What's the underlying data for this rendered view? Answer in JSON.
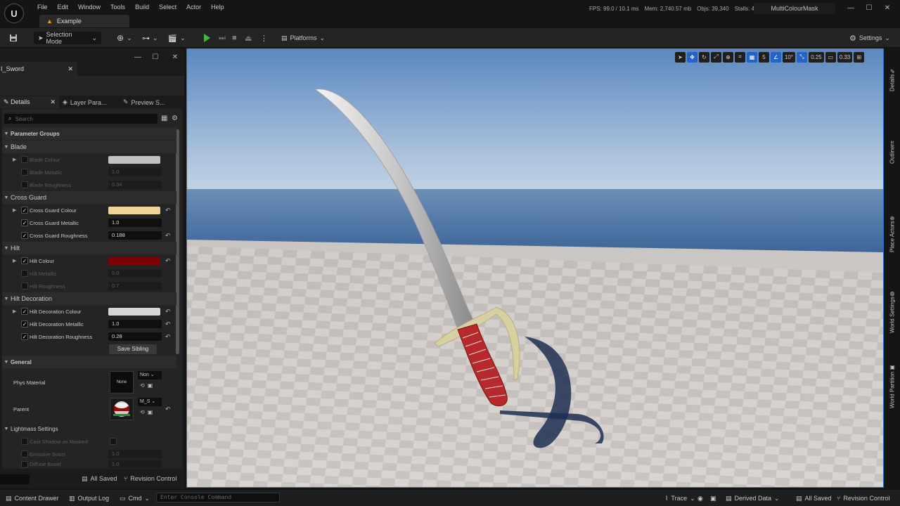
{
  "menu": [
    "File",
    "Edit",
    "Window",
    "Tools",
    "Build",
    "Select",
    "Actor",
    "Help"
  ],
  "level_tab": "Example",
  "stats": {
    "fps": "FPS: 99.0",
    "ms": "/ 10.1 ms",
    "mem": "Mem: 2,740.57 mb",
    "objs": "Objs: 39,340",
    "stalls": "Stalls: 4"
  },
  "project_name": "MultiColourMask",
  "toolbar": {
    "selection_mode": "Selection Mode",
    "platforms": "Platforms",
    "settings": "Settings"
  },
  "asset_tab": "I_Sword",
  "subtabs": [
    "Details",
    "Layer Para...",
    "Preview S..."
  ],
  "search_placeholder": "Search",
  "parameter_groups_label": "Parameter Groups",
  "groups": {
    "blade": {
      "label": "Blade",
      "colour_label": "Blade Colour",
      "colour_hex": "#c2c2c2",
      "metallic_label": "Blade Metallic",
      "metallic_value": "1.0",
      "roughness_label": "Blade Roughness",
      "roughness_value": "0.34"
    },
    "cross_guard": {
      "label": "Cross Guard",
      "colour_label": "Cross Guard Colour",
      "colour_hex": "#f0d39a",
      "metallic_label": "Cross Guard Metallic",
      "metallic_value": "1.0",
      "roughness_label": "Cross Guard Roughness",
      "roughness_value": "0.188"
    },
    "hilt": {
      "label": "Hilt",
      "colour_label": "Hilt Colour",
      "colour_hex": "#7a0404",
      "metallic_label": "Hilt Metallic",
      "metallic_value": "0.0",
      "roughness_label": "Hilt Roughness",
      "roughness_value": "0.7"
    },
    "hilt_decoration": {
      "label": "Hilt Decoration",
      "colour_label": "Hilt Decoration Colour",
      "colour_hex": "#d6d6d6",
      "metallic_label": "Hilt Decoration Metallic",
      "metallic_value": "1.0",
      "roughness_label": "Hilt Decoration Roughness",
      "roughness_value": "0.28"
    }
  },
  "save_sibling": "Save Sibling",
  "general": {
    "label": "General",
    "phys_material_label": "Phys Material",
    "phys_material_thumb": "None",
    "phys_material_value": "Non",
    "parent_label": "Parent",
    "parent_value": "M_S"
  },
  "lightmass": {
    "label": "Lightmass Settings",
    "cast_shadow_label": "Cast Shadow as Masked",
    "emissive_boost_label": "Emissive Boost",
    "emissive_boost_value": "1.0",
    "diffuse_boost_label": "Diffuse Boost",
    "diffuse_boost_value": "1.0"
  },
  "left_bottom": {
    "all_saved": "All Saved",
    "revision_control": "Revision Control"
  },
  "viewport_tools": {
    "grid_size": "5",
    "angle": "10°",
    "scale": "0.25",
    "camera_speed": "0.33"
  },
  "right_tabs": [
    "Details",
    "Outliner",
    "Place Actors",
    "World Settings",
    "World Partition"
  ],
  "status_bar": {
    "content_drawer": "Content Drawer",
    "output_log": "Output Log",
    "cmd": "Cmd",
    "console_placeholder": "Enter Console Command",
    "trace": "Trace",
    "derived_data": "Derived Data",
    "all_saved": "All Saved",
    "revision_control": "Revision Control"
  }
}
